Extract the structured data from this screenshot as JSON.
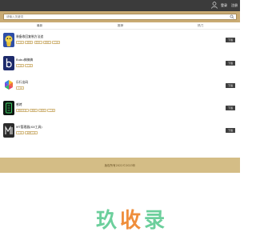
{
  "header": {
    "login_label": "登录",
    "register_label": "注册"
  },
  "search": {
    "placeholder": "请输入关键词"
  },
  "tabs": [
    {
      "label": "最新"
    },
    {
      "label": "推荐"
    },
    {
      "label": "热门"
    }
  ],
  "apps": [
    {
      "name": "装备收回复制方法追",
      "tags": [
        "工具",
        "游戏",
        "安卓",
        "游戏",
        "工具"
      ],
      "download_label": "下载"
    },
    {
      "name": "Bubu搞搞搞",
      "tags": [
        "工具",
        "工具"
      ],
      "download_label": "下载"
    },
    {
      "name": "乐行出码",
      "tags": [
        "工具"
      ],
      "download_label": "下载"
    },
    {
      "name": "感烤",
      "tags": [
        "游戏平台",
        "游戏",
        "游戏",
        "工具"
      ],
      "download_label": "下载"
    },
    {
      "name": "MT管理器(XX工具)",
      "tags": [
        "工具",
        "系统工具"
      ],
      "download_label": "下载"
    }
  ],
  "footer": {
    "text": "版权所有2022©2023年"
  },
  "watermark": {
    "text": "玖收录"
  },
  "colors": {
    "topbar": "#3b3b3b",
    "accent_gold": "#c9ab74",
    "footer_gold": "#d4bd86",
    "tag_text": "#b28f4b",
    "watermark_green": "#6ccf9c",
    "watermark_orange": "#ef8e3c"
  }
}
